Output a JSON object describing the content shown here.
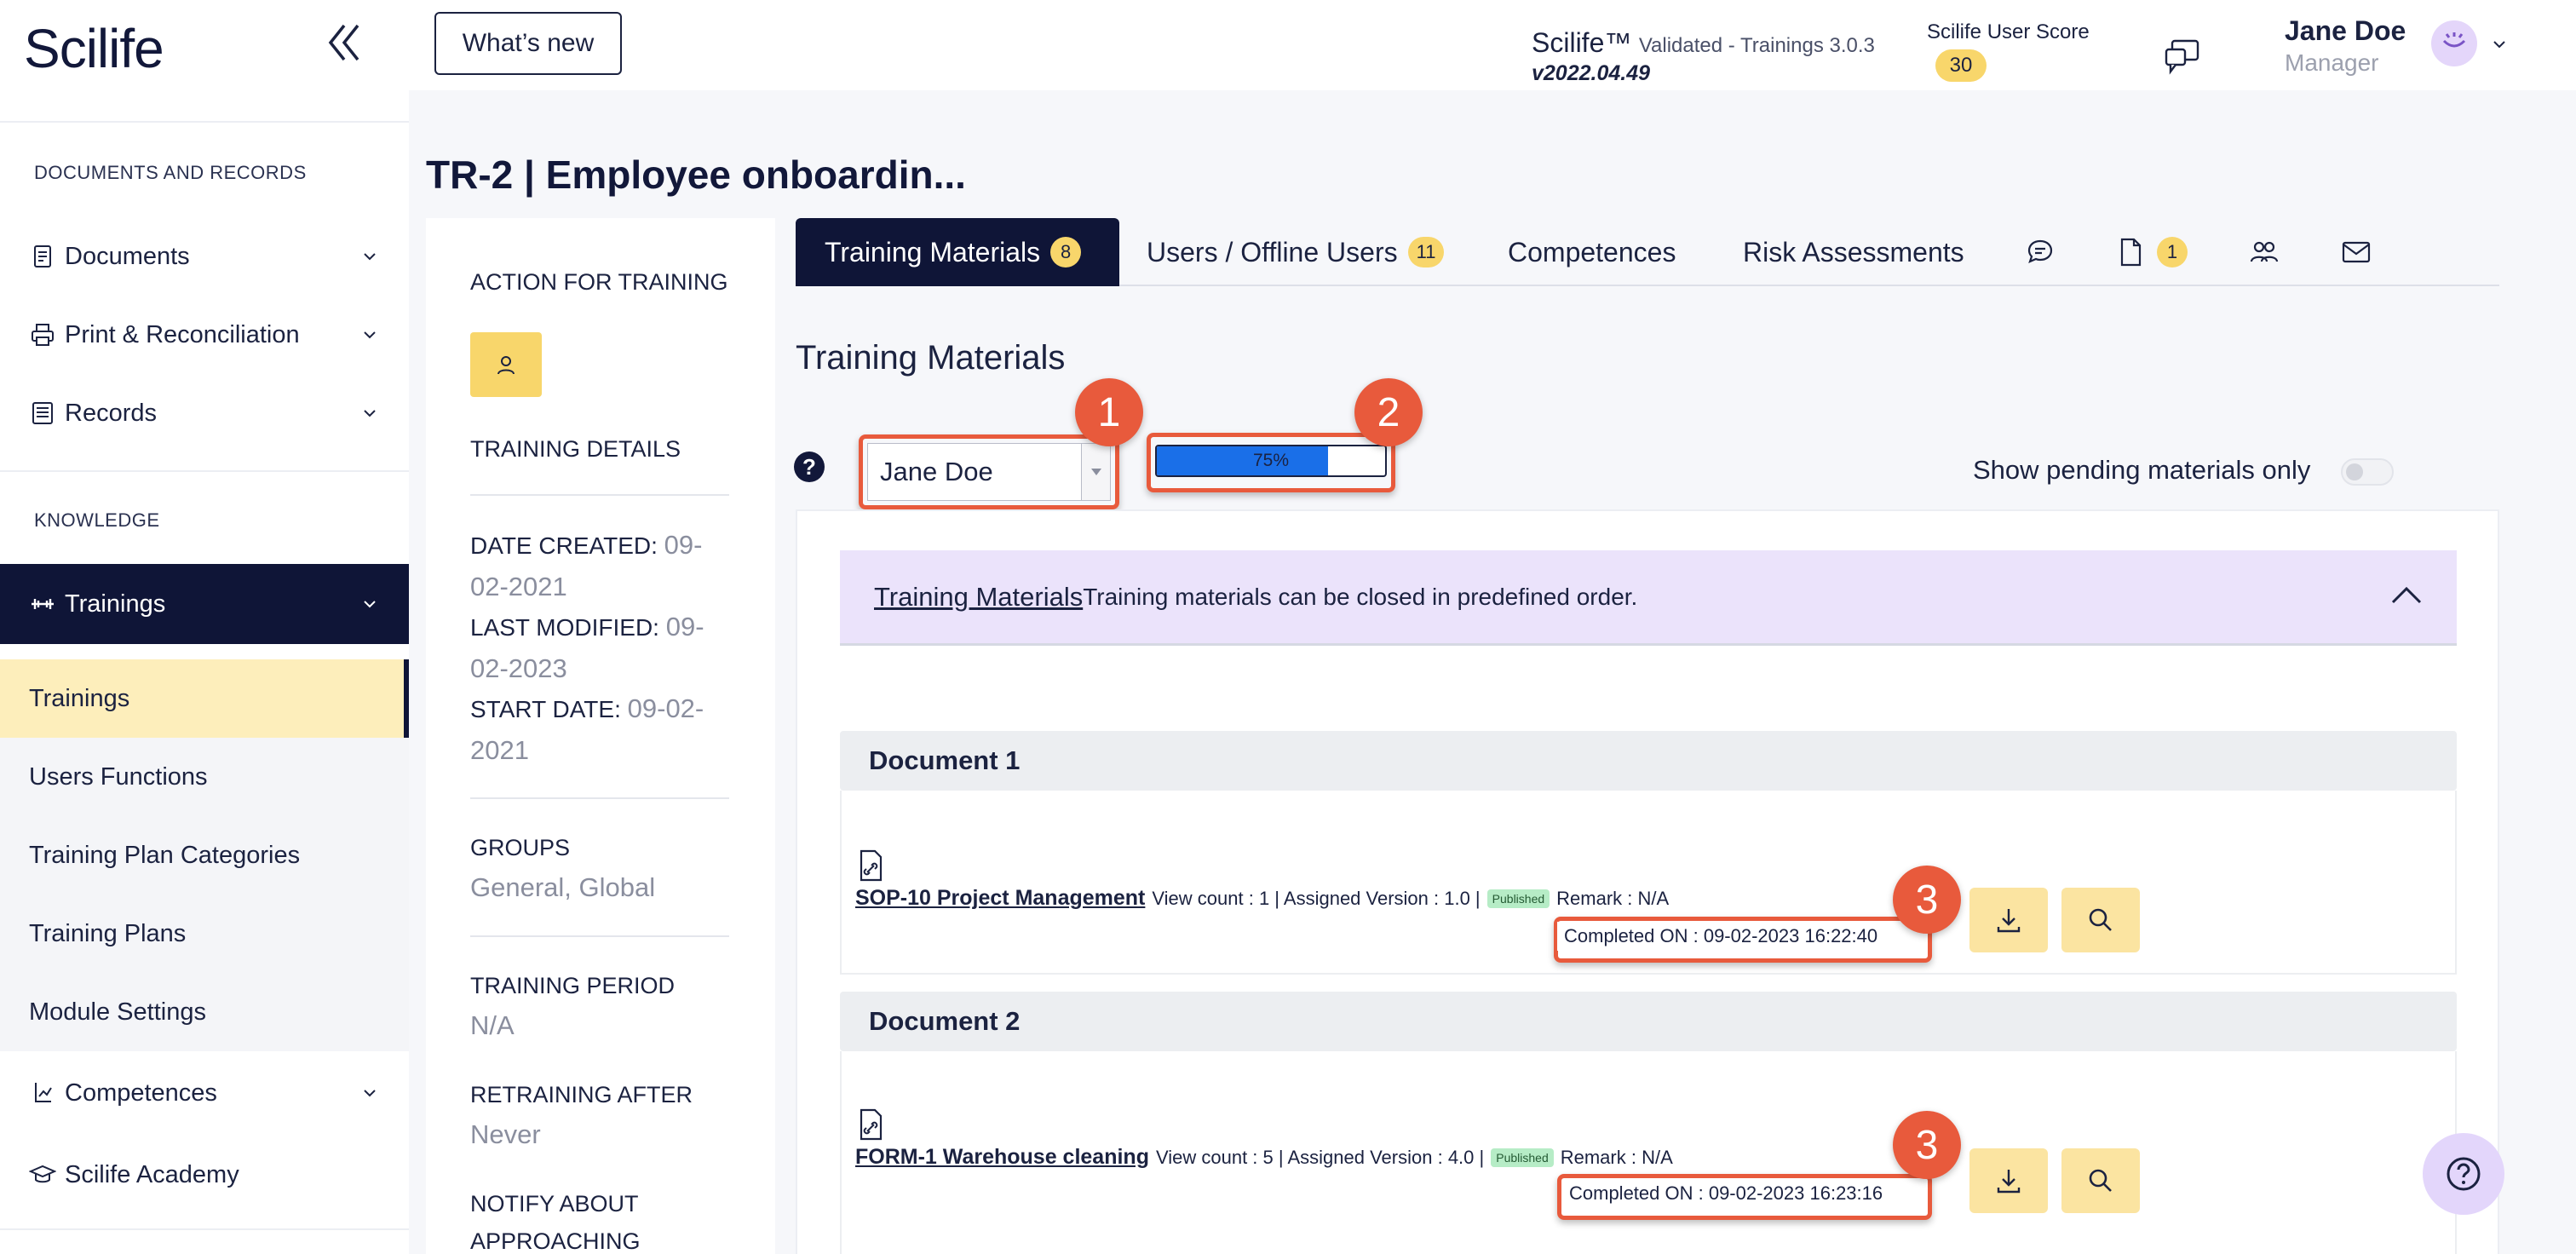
{
  "app": {
    "logo": "Scilife"
  },
  "header": {
    "whats_new": "What’s new",
    "product": "Scilife™",
    "product_detail": "Validated - Trainings 3.0.3",
    "version": "v2022.04.49",
    "score_label": "Scilife User Score",
    "score_value": "30",
    "user_name": "Jane Doe",
    "user_role": "Manager"
  },
  "sidebar": {
    "section_docs": "DOCUMENTS AND RECORDS",
    "documents": "Documents",
    "print": "Print & Reconciliation",
    "records": "Records",
    "section_knowledge": "KNOWLEDGE",
    "trainings_main": "Trainings",
    "subitems": [
      "Trainings",
      "Users Functions",
      "Training Plan Categories",
      "Training Plans",
      "Module Settings"
    ],
    "competences": "Competences",
    "academy": "Scilife Academy"
  },
  "page": {
    "title": "TR-2 | Employee onboardin..."
  },
  "details": {
    "action_title": "ACTION FOR TRAINING",
    "details_title": "TRAINING DETAILS",
    "date_created_label": "DATE CREATED:",
    "date_created": "09-02-2021",
    "last_modified_label": "LAST MODIFIED:",
    "last_modified": "09-02-2023",
    "start_date_label": "START DATE:",
    "start_date": "09-02-2021",
    "groups_label": "GROUPS",
    "groups": "General, Global",
    "period_label": "TRAINING PERIOD",
    "period": "N/A",
    "retraining_label": "RETRAINING AFTER",
    "retraining": "Never",
    "notify_label_1": "NOTIFY ABOUT",
    "notify_label_2": "APPROACHING"
  },
  "tabs": {
    "materials": "Training Materials",
    "materials_count": "8",
    "users": "Users / Offline Users",
    "users_count": "11",
    "competences": "Competences",
    "risk": "Risk Assessments",
    "docs_count": "1"
  },
  "materials": {
    "heading": "Training Materials",
    "user_select": "Jane Doe",
    "progress_text": "75%",
    "progress": 0.75,
    "pending_label": "Show pending materials only",
    "banner_link": "Training Materials",
    "banner_text": "Training materials can be closed in predefined order."
  },
  "annotations": [
    "1",
    "2",
    "3",
    "3"
  ],
  "documents": [
    {
      "group": "Document 1",
      "name": "SOP-10 Project Management",
      "meta": "View count : 1 | Assigned Version : 1.0 |",
      "status": "Published",
      "remark": "Remark : N/A",
      "completed": "Completed ON : 09-02-2023 16:22:40"
    },
    {
      "group": "Document 2",
      "name": "FORM-1 Warehouse cleaning",
      "meta": "View count : 5 | Assigned Version : 4.0 |",
      "status": "Published",
      "remark": "Remark : N/A",
      "completed": "Completed ON : 09-02-2023 16:23:16"
    }
  ],
  "colors": {
    "navy": "#0f1537",
    "accent": "#f8d66b",
    "annotation": "#e85a3c",
    "progress": "#1a6fe8",
    "banner": "#ebe3fb"
  }
}
